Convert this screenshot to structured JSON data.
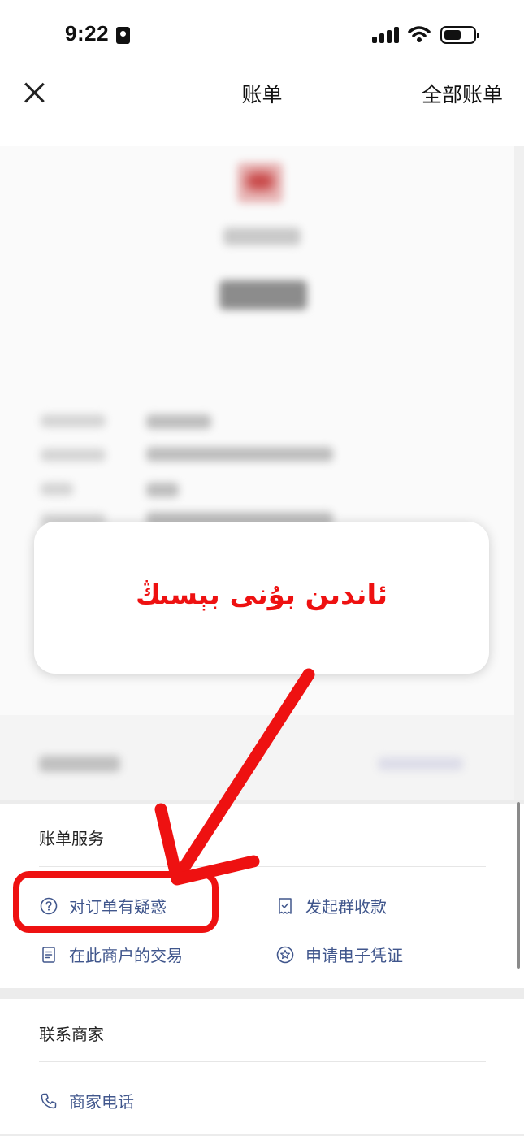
{
  "status_bar": {
    "time": "9:22"
  },
  "nav": {
    "title": "账单",
    "right_label": "全部账单"
  },
  "annotation": {
    "text": "ئاندىن بۇنى بېسىڭ",
    "color": "#ee1111"
  },
  "bill_services": {
    "title": "账单服务",
    "items": [
      {
        "label": "对订单有疑惑",
        "icon": "question-circle-icon"
      },
      {
        "label": "发起群收款",
        "icon": "receipt-check-icon"
      },
      {
        "label": "在此商户的交易",
        "icon": "document-icon"
      },
      {
        "label": "申请电子凭证",
        "icon": "star-circle-icon"
      }
    ]
  },
  "contact_merchant": {
    "title": "联系商家",
    "items": [
      {
        "label": "商家电话",
        "icon": "phone-icon"
      }
    ]
  },
  "colors": {
    "link": "#40568c",
    "annotation": "#ee1111"
  }
}
